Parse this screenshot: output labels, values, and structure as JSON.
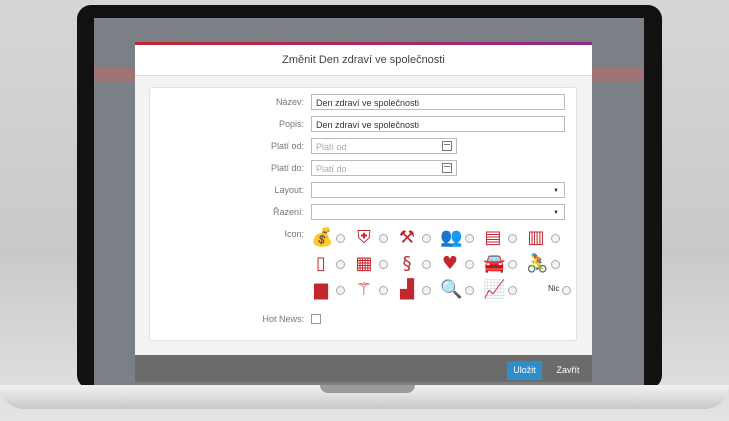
{
  "dialog": {
    "title": "Změnit Den zdraví ve společnosti",
    "fields": {
      "name": {
        "label": "Název:",
        "value": "Den zdraví ve společnosti"
      },
      "description": {
        "label": "Popis:",
        "value": "Den zdraví ve společnosti"
      },
      "valid_from": {
        "label": "Platí od:",
        "placeholder": "Platí od"
      },
      "valid_to": {
        "label": "Platí do:",
        "placeholder": "Platí do"
      },
      "layout": {
        "label": "Layout:",
        "value": ""
      },
      "sort": {
        "label": "Řazení:",
        "value": ""
      },
      "icon": {
        "label": "Icon:",
        "none_label": "Nic"
      },
      "hot_news": {
        "label": "Hot News:",
        "checked": false
      }
    },
    "buttons": {
      "save": "Uložit",
      "close": "Zavřít"
    }
  },
  "icon_rows": [
    [
      "money-hand-icon",
      "shield-icon",
      "gavel-icon",
      "team-icon",
      "certificate-icon",
      "books-icon"
    ],
    [
      "mobile-signal-icon",
      "calculator-icon",
      "paragraph-icon",
      "heart-hand-icon",
      "car-icon",
      "cycling-icon"
    ],
    [
      "factory-icon",
      "power-tower-icon",
      "coins-icon",
      "magnify-person-icon",
      "growth-chart-icon"
    ]
  ],
  "colors": {
    "accent": "#c2262f",
    "primary_button": "#2e8ec9"
  }
}
